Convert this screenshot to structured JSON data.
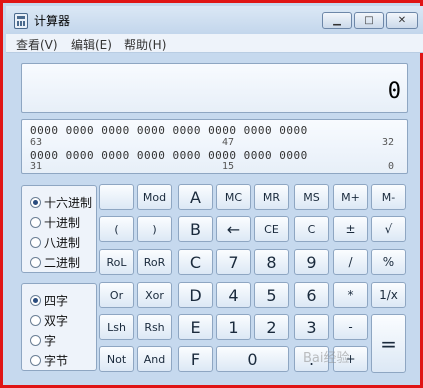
{
  "window": {
    "title": "计算器",
    "min_label": "▁",
    "max_label": "□",
    "close_label": "✕"
  },
  "menu": [
    "查看(V)",
    "编辑(E)",
    "帮助(H)"
  ],
  "display": {
    "value": "0"
  },
  "bits": {
    "row1": "0000  0000  0000  0000  0000  0000  0000  0000",
    "row1_marks": [
      "63",
      "47",
      "32"
    ],
    "row2": "0000  0000  0000  0000  0000  0000  0000  0000",
    "row2_marks": [
      "31",
      "15",
      "0"
    ]
  },
  "base_radios": [
    {
      "label": "十六进制",
      "selected": true
    },
    {
      "label": "十进制",
      "selected": false
    },
    {
      "label": "八进制",
      "selected": false
    },
    {
      "label": "二进制",
      "selected": false
    }
  ],
  "word_radios": [
    {
      "label": "四字",
      "selected": true
    },
    {
      "label": "双字",
      "selected": false
    },
    {
      "label": "字",
      "selected": false
    },
    {
      "label": "字节",
      "selected": false
    }
  ],
  "buttons": {
    "row1": [
      "",
      "Mod",
      "A",
      "MC",
      "MR",
      "MS",
      "M+",
      "M-"
    ],
    "row2": [
      "(",
      ")",
      "B",
      "←",
      "CE",
      "C",
      "±",
      "√"
    ],
    "row3": [
      "RoL",
      "RoR",
      "C",
      "7",
      "8",
      "9",
      "/",
      "%"
    ],
    "row4": [
      "Or",
      "Xor",
      "D",
      "4",
      "5",
      "6",
      "*",
      "1/x"
    ],
    "row5": [
      "Lsh",
      "Rsh",
      "E",
      "1",
      "2",
      "3",
      "-"
    ],
    "row6": [
      "Not",
      "And",
      "F",
      "0",
      ".",
      "+"
    ],
    "equals": "="
  },
  "watermark": "Bai经验"
}
